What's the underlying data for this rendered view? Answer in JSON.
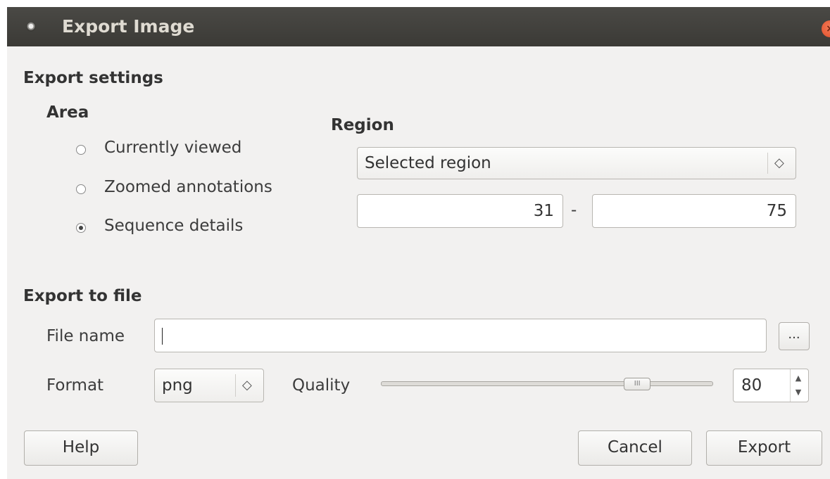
{
  "window": {
    "title": "Export Image",
    "close_icon": "×"
  },
  "export_settings": {
    "title": "Export settings",
    "area": {
      "title": "Area",
      "options": [
        {
          "label": "Currently viewed",
          "checked": false
        },
        {
          "label": "Zoomed annotations",
          "checked": false
        },
        {
          "label": "Sequence details",
          "checked": true
        }
      ]
    },
    "region": {
      "title": "Region",
      "selected": "Selected region",
      "combo_arrows": "◇",
      "from": "31",
      "separator": "-",
      "to": "75"
    }
  },
  "export_to_file": {
    "title": "Export to file",
    "file_name_label": "File name",
    "file_name_value": "",
    "browse_label": "...",
    "format_label": "Format",
    "format_value": "png",
    "quality_label": "Quality",
    "quality_value": "80",
    "quality_max": "100",
    "slider_grip": "III",
    "spin_up": "▲",
    "spin_down": "▼"
  },
  "buttons": {
    "help": "Help",
    "cancel": "Cancel",
    "export": "Export"
  }
}
